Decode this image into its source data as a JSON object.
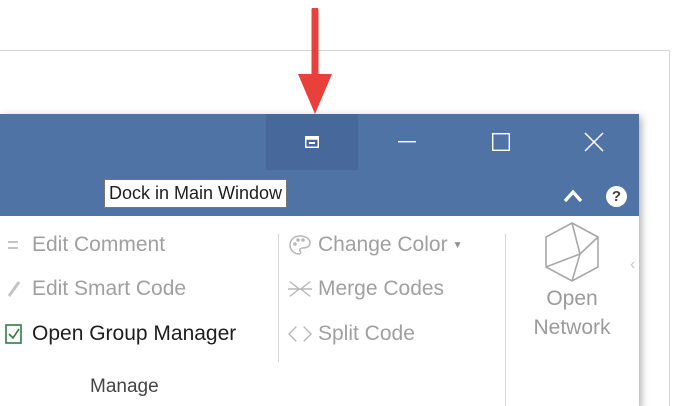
{
  "tooltip": {
    "text": "Dock in Main Window"
  },
  "titlebar": {
    "color": "#5073a6",
    "buttons": [
      {
        "name": "dock",
        "icon": "dock-window-icon"
      },
      {
        "name": "minimize",
        "icon": "minimize-icon"
      },
      {
        "name": "maximize",
        "icon": "maximize-icon"
      },
      {
        "name": "close",
        "icon": "close-icon"
      }
    ],
    "collapse_icon": "chevron-up-icon",
    "help_label": "?"
  },
  "ribbon": {
    "items_col1": [
      {
        "label": "Edit Comment",
        "icon": "comment-icon",
        "enabled": false
      },
      {
        "label": "Edit Smart Code",
        "icon": "pencil-icon",
        "enabled": false
      },
      {
        "label": "Open Group Manager",
        "icon": "group-manager-icon",
        "enabled": true
      }
    ],
    "items_col2": [
      {
        "label": "Change Color",
        "icon": "palette-icon",
        "enabled": false,
        "dropdown": true
      },
      {
        "label": "Merge Codes",
        "icon": "merge-icon",
        "enabled": false
      },
      {
        "label": "Split Code",
        "icon": "split-icon",
        "enabled": false
      }
    ],
    "group_label": "Manage",
    "big_button": {
      "label_line1": "Open",
      "label_line2": "Network",
      "icon": "network-icon"
    }
  },
  "annotation": {
    "arrow_color": "#e8403a"
  }
}
